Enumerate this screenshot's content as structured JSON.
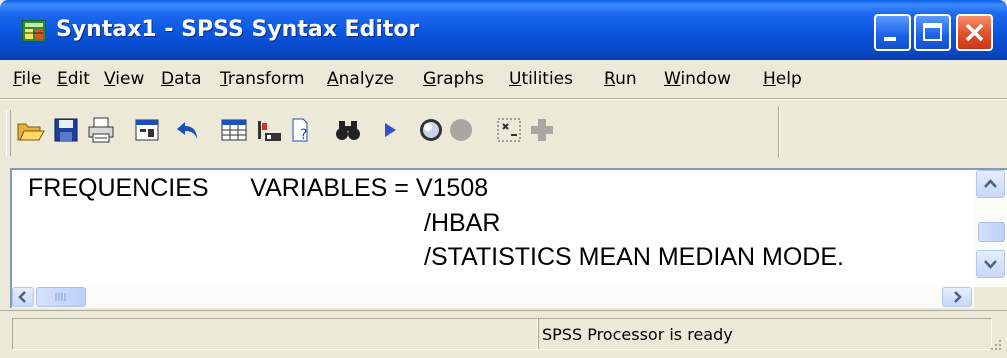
{
  "window": {
    "title": "Syntax1 - SPSS Syntax Editor",
    "controls": {
      "minimize_icon": "minimize-icon",
      "maximize_icon": "maximize-icon",
      "close_icon": "close-icon"
    }
  },
  "menu": {
    "items": [
      {
        "label": "File",
        "mnemonic": "F",
        "rest": "ile"
      },
      {
        "label": "Edit",
        "mnemonic": "E",
        "rest": "dit"
      },
      {
        "label": "View",
        "mnemonic": "V",
        "rest": "iew"
      },
      {
        "label": "Data",
        "mnemonic": "D",
        "rest": "ata"
      },
      {
        "label": "Transform",
        "mnemonic": "T",
        "rest": "ransform"
      },
      {
        "label": "Analyze",
        "mnemonic": "A",
        "rest": "nalyze"
      },
      {
        "label": "Graphs",
        "mnemonic": "G",
        "rest": "raphs"
      },
      {
        "label": "Utilities",
        "mnemonic": "U",
        "rest": "tilities"
      },
      {
        "label": "Run",
        "mnemonic": "R",
        "rest": "un"
      },
      {
        "label": "Window",
        "mnemonic": "W",
        "rest": "indow"
      },
      {
        "label": "Help",
        "mnemonic": "H",
        "rest": "elp"
      }
    ]
  },
  "toolbar": {
    "buttons": [
      "open-folder-icon",
      "save-icon",
      "print-icon",
      "dialog-recall-icon",
      "undo-icon",
      "goto-case-icon",
      "variables-icon",
      "find-icon",
      "binoculars-icon",
      "run-icon",
      "syntax-help-icon",
      "use-sets-icon",
      "split-window-icon",
      "add-icon"
    ]
  },
  "editor": {
    "lines": [
      "FREQUENCIES      VARIABLES = V1508",
      "/HBAR",
      "/STATISTICS MEAN MEDIAN MODE."
    ]
  },
  "status": {
    "text": "SPSS Processor is ready"
  },
  "colors": {
    "titlebar": "#0a55de",
    "chrome": "#ece9d8",
    "close_button": "#e0502a",
    "editor_border": "#7f9db9"
  }
}
